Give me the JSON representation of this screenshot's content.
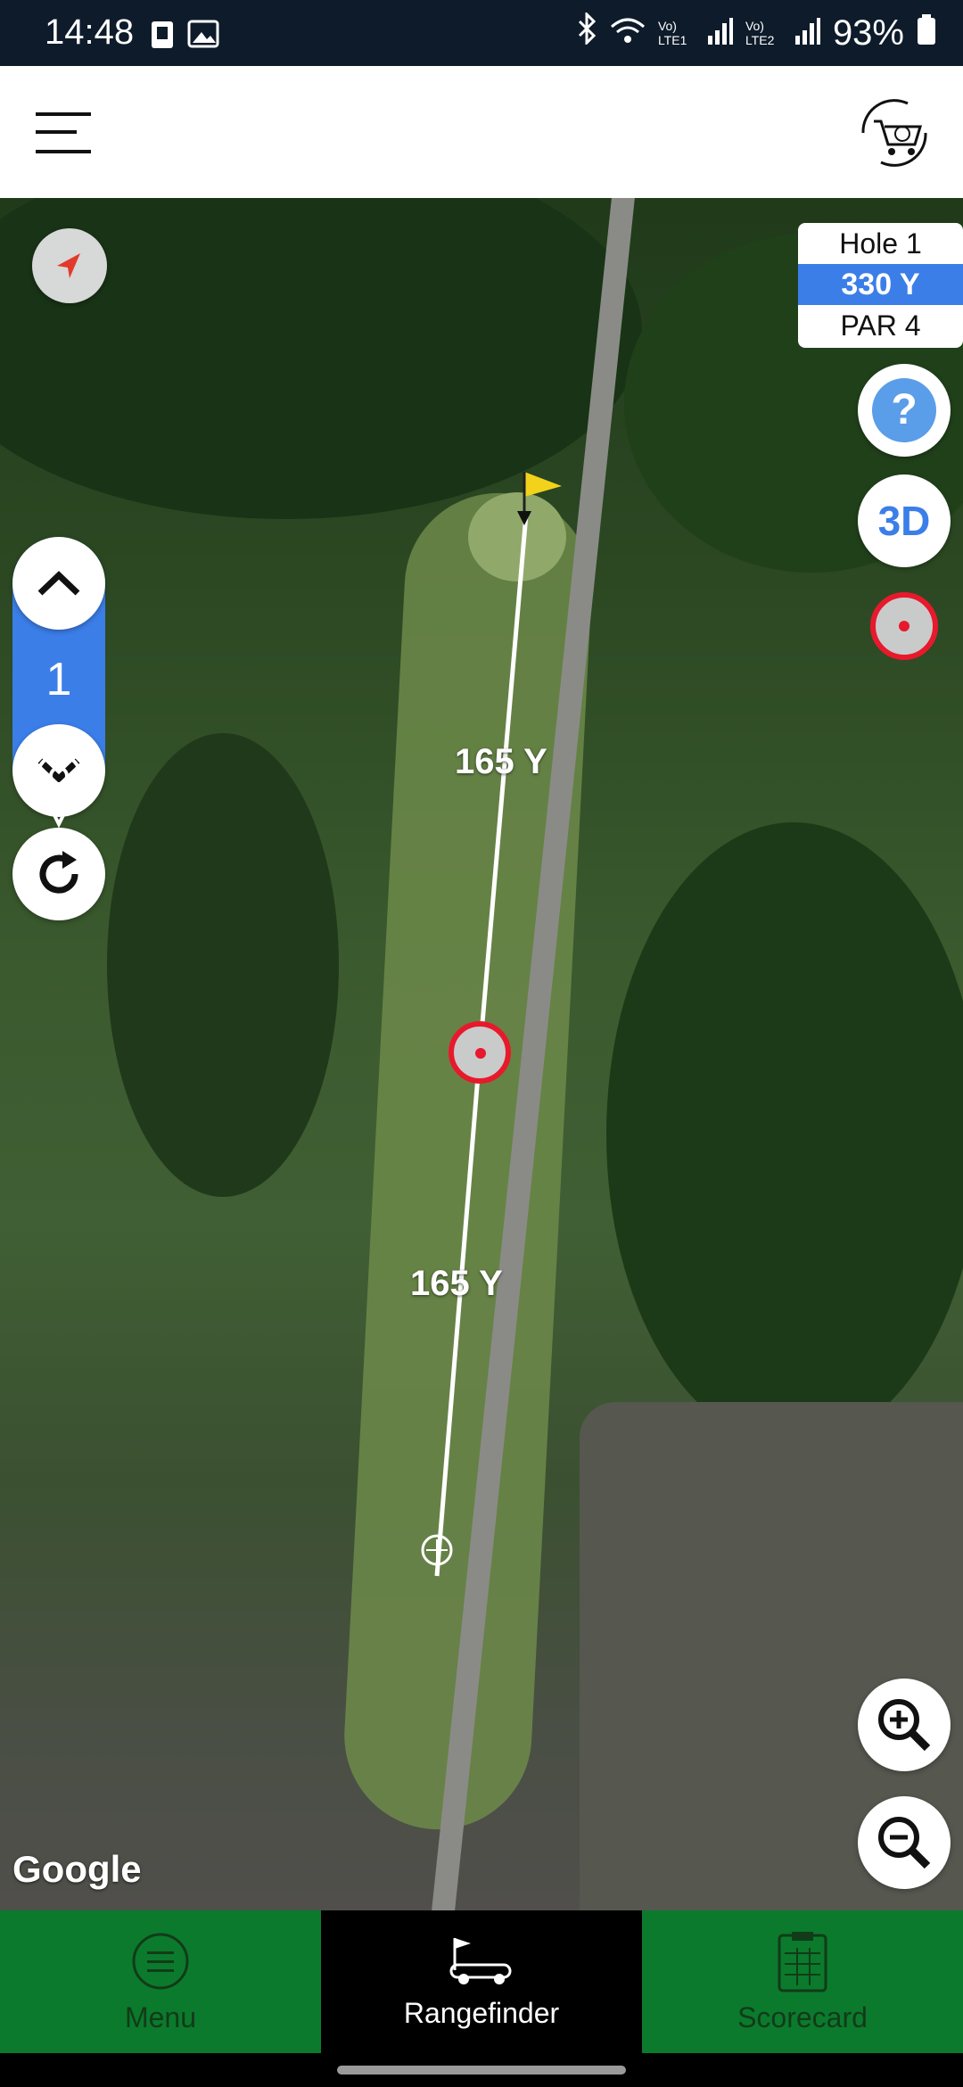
{
  "status_bar": {
    "time": "14:48",
    "lte1": "Vo) LTE1",
    "lte2": "Vo) LTE2",
    "battery": "93%"
  },
  "header": {
    "menu_icon": "hamburger-icon",
    "cart_icon": "cart-icon"
  },
  "hole_info": {
    "hole": "Hole 1",
    "yardage": "330 Y",
    "par": "PAR 4"
  },
  "controls": {
    "hole_number": "1",
    "help_label": "?",
    "three_d_label": "3D"
  },
  "map": {
    "segment_top": "165 Y",
    "segment_bottom": "165 Y",
    "attribution": "Google"
  },
  "nav": {
    "items": [
      {
        "label": "Menu"
      },
      {
        "label": "Rangefinder"
      },
      {
        "label": "Scorecard"
      }
    ]
  },
  "colors": {
    "accent": "#3b7ee8",
    "nav_green": "#0b7a2c",
    "target_red": "#e8192c"
  }
}
